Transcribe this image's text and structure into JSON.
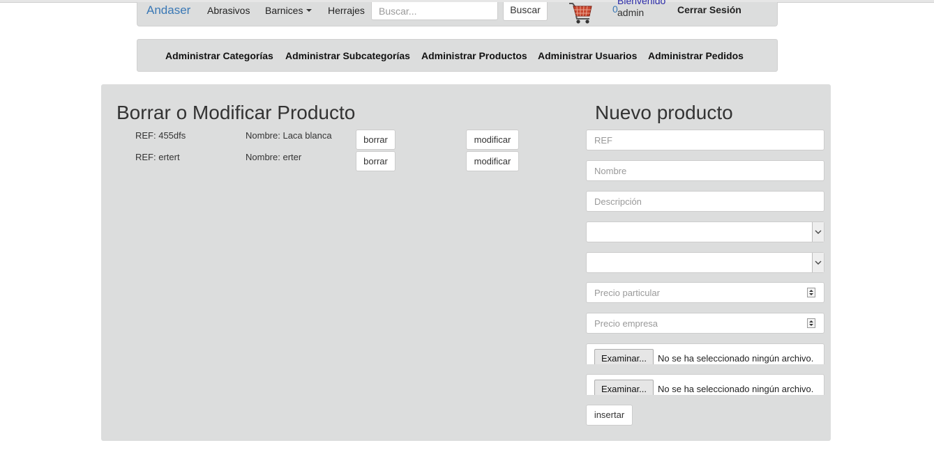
{
  "navbar": {
    "brand": "Andaser",
    "links": [
      "Abrasivos",
      "Barnices",
      "Herrajes"
    ],
    "search_placeholder": "Buscar...",
    "search_button": "Buscar",
    "cart_count": "0",
    "welcome": "Bienvenido",
    "username": "admin",
    "logout": "Cerrar Sesión",
    "brand_color": "#3a78b5"
  },
  "admin_menu": {
    "items": [
      "Administrar Categorías",
      "Administrar Subcategorías",
      "Administrar Productos",
      "Administrar Usuarios",
      "Administrar Pedidos"
    ]
  },
  "products": {
    "title": "Borrar o Modificar Producto",
    "rows": [
      {
        "ref": "REF: 455dfs",
        "name": "Nombre: Laca blanca",
        "delete": "borrar",
        "edit": "modificar"
      },
      {
        "ref": "REF: ertert",
        "name": "Nombre: erter",
        "delete": "borrar",
        "edit": "modificar"
      }
    ]
  },
  "new_product": {
    "title": "Nuevo producto",
    "ref_placeholder": "REF",
    "name_placeholder": "Nombre",
    "desc_placeholder": "Descripción",
    "category_value": "",
    "subcategory_value": "",
    "price_private_placeholder": "Precio particular",
    "price_company_placeholder": "Precio empresa",
    "file1_button": "Examinar...",
    "file1_text": "No se ha seleccionado ningún archivo.",
    "file2_button": "Examinar...",
    "file2_text": "No se ha seleccionado ningún archivo.",
    "submit": "insertar"
  }
}
